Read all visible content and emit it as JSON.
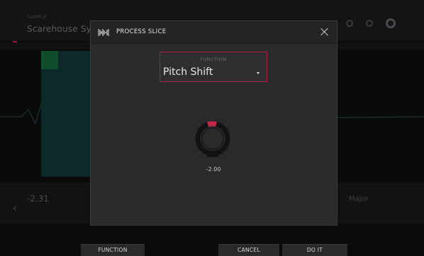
{
  "background": {
    "title": "Scarehouse Sy",
    "small_label": "SAMPLE",
    "bottom_value": "-2.31",
    "bottom_right": "Major"
  },
  "dialog": {
    "title": "PROCESS SLICE",
    "function_label": "FUNCTION",
    "function_value": "Pitch Shift",
    "knob_value": "-2.00",
    "icon": "waveform-icon"
  },
  "softkeys": {
    "function": "FUNCTION",
    "cancel": "CANCEL",
    "do_it": "DO IT"
  },
  "colors": {
    "accent": "#b21f3e",
    "knob_ring": "#121214",
    "dialog_bg": "#2a2a2c"
  }
}
